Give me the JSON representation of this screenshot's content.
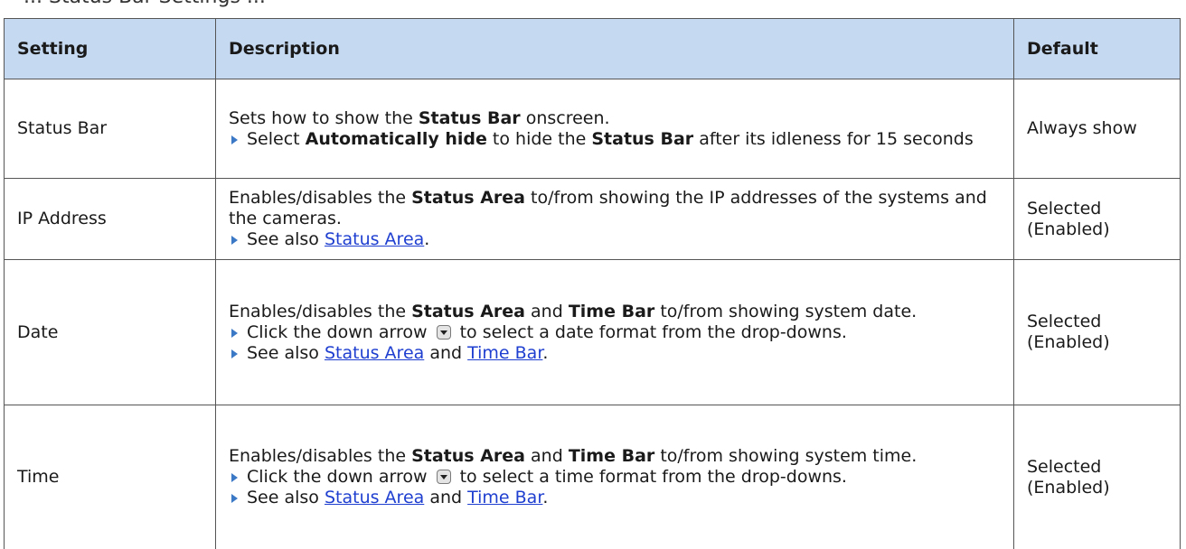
{
  "section_heading": "... Status Bar Settings ...",
  "columns": {
    "setting": "Setting",
    "description": "Description",
    "default": "Default"
  },
  "rows": [
    {
      "setting": "Status Bar",
      "description_intro": [
        "Sets how to show the ",
        "Status Bar",
        " onscreen."
      ],
      "bullet1": [
        "Select ",
        "Automatically hide",
        " to hide the ",
        "Status Bar",
        " after its idleness for 15 seconds"
      ],
      "default": "Always show"
    },
    {
      "setting": "IP Address",
      "description_intro": [
        "Enables/disables the ",
        "Status Area",
        " to/from showing the IP addresses of the systems and the cameras."
      ],
      "bullet1": [
        "See also ",
        "Status Area",
        "."
      ],
      "default_line1": "Selected",
      "default_line2": "(Enabled)"
    },
    {
      "setting": "Date",
      "description_intro": [
        "Enables/disables the ",
        "Status Area",
        " and ",
        "Time Bar",
        " to/from showing system date."
      ],
      "bullet1": [
        "Click the down arrow",
        "to select a date format from the drop-downs."
      ],
      "bullet2": [
        "See also ",
        "Status Area",
        " and ",
        "Time Bar",
        "."
      ],
      "default_line1": "Selected",
      "default_line2": "(Enabled)"
    },
    {
      "setting": "Time",
      "description_intro": [
        "Enables/disables the ",
        "Status Area",
        " and ",
        "Time Bar",
        " to/from showing system time."
      ],
      "bullet1": [
        "Click the down arrow",
        "to select a time format from the drop-downs."
      ],
      "bullet2": [
        "See also ",
        "Status Area",
        " and ",
        "Time Bar",
        "."
      ],
      "default_line1": "Selected",
      "default_line2": "(Enabled)"
    }
  ],
  "colors": {
    "header_bg": "#c5d9f1",
    "link": "#1f3fd0",
    "bullet": "#3b78c6",
    "border": "#555555"
  },
  "icons": {
    "bullet": "triangle-right-bullet-icon",
    "dropdown": "dropdown-arrow-icon"
  }
}
